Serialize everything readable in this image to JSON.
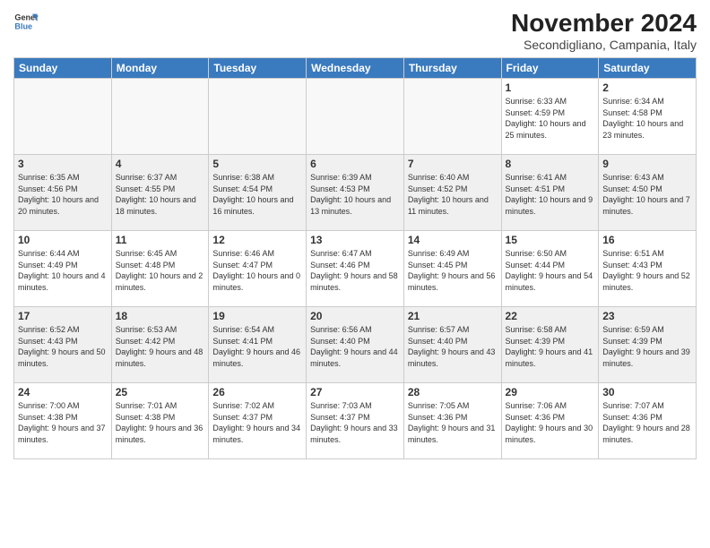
{
  "header": {
    "logo_line1": "General",
    "logo_line2": "Blue",
    "month": "November 2024",
    "location": "Secondigliano, Campania, Italy"
  },
  "weekdays": [
    "Sunday",
    "Monday",
    "Tuesday",
    "Wednesday",
    "Thursday",
    "Friday",
    "Saturday"
  ],
  "weeks": [
    [
      {
        "day": "",
        "info": ""
      },
      {
        "day": "",
        "info": ""
      },
      {
        "day": "",
        "info": ""
      },
      {
        "day": "",
        "info": ""
      },
      {
        "day": "",
        "info": ""
      },
      {
        "day": "1",
        "info": "Sunrise: 6:33 AM\nSunset: 4:59 PM\nDaylight: 10 hours and 25 minutes."
      },
      {
        "day": "2",
        "info": "Sunrise: 6:34 AM\nSunset: 4:58 PM\nDaylight: 10 hours and 23 minutes."
      }
    ],
    [
      {
        "day": "3",
        "info": "Sunrise: 6:35 AM\nSunset: 4:56 PM\nDaylight: 10 hours and 20 minutes."
      },
      {
        "day": "4",
        "info": "Sunrise: 6:37 AM\nSunset: 4:55 PM\nDaylight: 10 hours and 18 minutes."
      },
      {
        "day": "5",
        "info": "Sunrise: 6:38 AM\nSunset: 4:54 PM\nDaylight: 10 hours and 16 minutes."
      },
      {
        "day": "6",
        "info": "Sunrise: 6:39 AM\nSunset: 4:53 PM\nDaylight: 10 hours and 13 minutes."
      },
      {
        "day": "7",
        "info": "Sunrise: 6:40 AM\nSunset: 4:52 PM\nDaylight: 10 hours and 11 minutes."
      },
      {
        "day": "8",
        "info": "Sunrise: 6:41 AM\nSunset: 4:51 PM\nDaylight: 10 hours and 9 minutes."
      },
      {
        "day": "9",
        "info": "Sunrise: 6:43 AM\nSunset: 4:50 PM\nDaylight: 10 hours and 7 minutes."
      }
    ],
    [
      {
        "day": "10",
        "info": "Sunrise: 6:44 AM\nSunset: 4:49 PM\nDaylight: 10 hours and 4 minutes."
      },
      {
        "day": "11",
        "info": "Sunrise: 6:45 AM\nSunset: 4:48 PM\nDaylight: 10 hours and 2 minutes."
      },
      {
        "day": "12",
        "info": "Sunrise: 6:46 AM\nSunset: 4:47 PM\nDaylight: 10 hours and 0 minutes."
      },
      {
        "day": "13",
        "info": "Sunrise: 6:47 AM\nSunset: 4:46 PM\nDaylight: 9 hours and 58 minutes."
      },
      {
        "day": "14",
        "info": "Sunrise: 6:49 AM\nSunset: 4:45 PM\nDaylight: 9 hours and 56 minutes."
      },
      {
        "day": "15",
        "info": "Sunrise: 6:50 AM\nSunset: 4:44 PM\nDaylight: 9 hours and 54 minutes."
      },
      {
        "day": "16",
        "info": "Sunrise: 6:51 AM\nSunset: 4:43 PM\nDaylight: 9 hours and 52 minutes."
      }
    ],
    [
      {
        "day": "17",
        "info": "Sunrise: 6:52 AM\nSunset: 4:43 PM\nDaylight: 9 hours and 50 minutes."
      },
      {
        "day": "18",
        "info": "Sunrise: 6:53 AM\nSunset: 4:42 PM\nDaylight: 9 hours and 48 minutes."
      },
      {
        "day": "19",
        "info": "Sunrise: 6:54 AM\nSunset: 4:41 PM\nDaylight: 9 hours and 46 minutes."
      },
      {
        "day": "20",
        "info": "Sunrise: 6:56 AM\nSunset: 4:40 PM\nDaylight: 9 hours and 44 minutes."
      },
      {
        "day": "21",
        "info": "Sunrise: 6:57 AM\nSunset: 4:40 PM\nDaylight: 9 hours and 43 minutes."
      },
      {
        "day": "22",
        "info": "Sunrise: 6:58 AM\nSunset: 4:39 PM\nDaylight: 9 hours and 41 minutes."
      },
      {
        "day": "23",
        "info": "Sunrise: 6:59 AM\nSunset: 4:39 PM\nDaylight: 9 hours and 39 minutes."
      }
    ],
    [
      {
        "day": "24",
        "info": "Sunrise: 7:00 AM\nSunset: 4:38 PM\nDaylight: 9 hours and 37 minutes."
      },
      {
        "day": "25",
        "info": "Sunrise: 7:01 AM\nSunset: 4:38 PM\nDaylight: 9 hours and 36 minutes."
      },
      {
        "day": "26",
        "info": "Sunrise: 7:02 AM\nSunset: 4:37 PM\nDaylight: 9 hours and 34 minutes."
      },
      {
        "day": "27",
        "info": "Sunrise: 7:03 AM\nSunset: 4:37 PM\nDaylight: 9 hours and 33 minutes."
      },
      {
        "day": "28",
        "info": "Sunrise: 7:05 AM\nSunset: 4:36 PM\nDaylight: 9 hours and 31 minutes."
      },
      {
        "day": "29",
        "info": "Sunrise: 7:06 AM\nSunset: 4:36 PM\nDaylight: 9 hours and 30 minutes."
      },
      {
        "day": "30",
        "info": "Sunrise: 7:07 AM\nSunset: 4:36 PM\nDaylight: 9 hours and 28 minutes."
      }
    ]
  ]
}
